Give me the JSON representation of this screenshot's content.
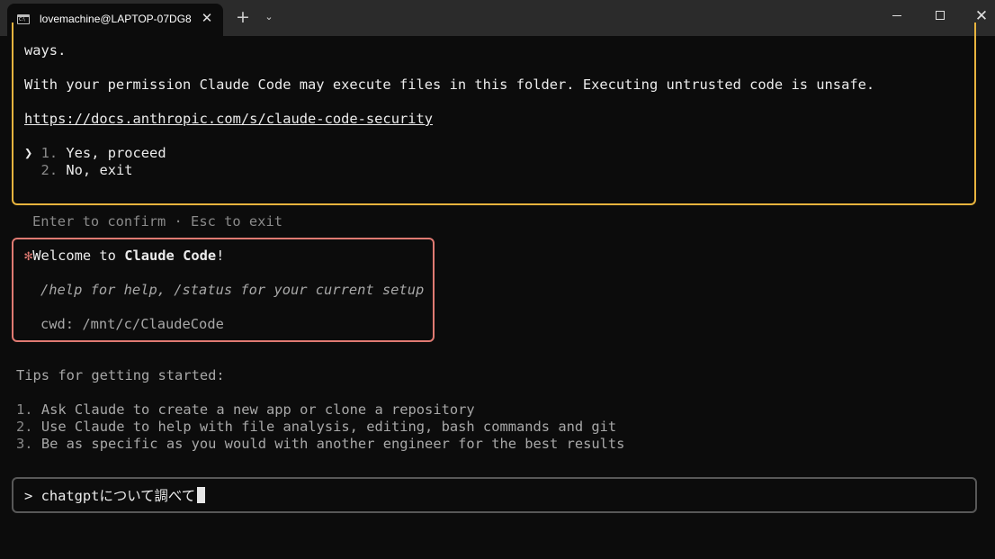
{
  "window": {
    "tab_title": "lovemachine@LAPTOP-07DG8",
    "tab_close_glyph": "✕",
    "new_tab_glyph": "+",
    "dropdown_glyph": "⌄",
    "close_glyph": "✕"
  },
  "trust_prompt": {
    "line_ways": "ways.",
    "permission_text": "With your permission Claude Code may execute files in this folder. Executing untrusted code is unsafe.",
    "security_url": "https://docs.anthropic.com/s/claude-code-security",
    "selector_glyph": "❯",
    "options": [
      {
        "number": "1.",
        "label": "Yes, proceed"
      },
      {
        "number": "2.",
        "label": "No, exit"
      }
    ],
    "hint": "Enter to confirm · Esc to exit"
  },
  "welcome": {
    "asterisk": "✻",
    "prefix": "Welcome to ",
    "product": "Claude Code",
    "suffix": "!",
    "help_text": "/help for help, /status for your current setup",
    "cwd": "cwd: /mnt/c/ClaudeCode"
  },
  "tips": {
    "heading": "Tips for getting started:",
    "items": [
      {
        "number": "1.",
        "text": "Ask Claude to create a new app or clone a repository"
      },
      {
        "number": "2.",
        "text": "Use Claude to help with file analysis, editing, bash commands and git"
      },
      {
        "number": "3.",
        "text": "Be as specific as you would with another engineer for the best results"
      }
    ]
  },
  "input": {
    "prompt": ">",
    "value_latin": "chatgpt",
    "value_jp": "について調べて"
  },
  "colors": {
    "trust_border": "#e8b43e",
    "welcome_border": "#e07a72",
    "input_border": "#585858",
    "background": "#0c0c0c"
  }
}
